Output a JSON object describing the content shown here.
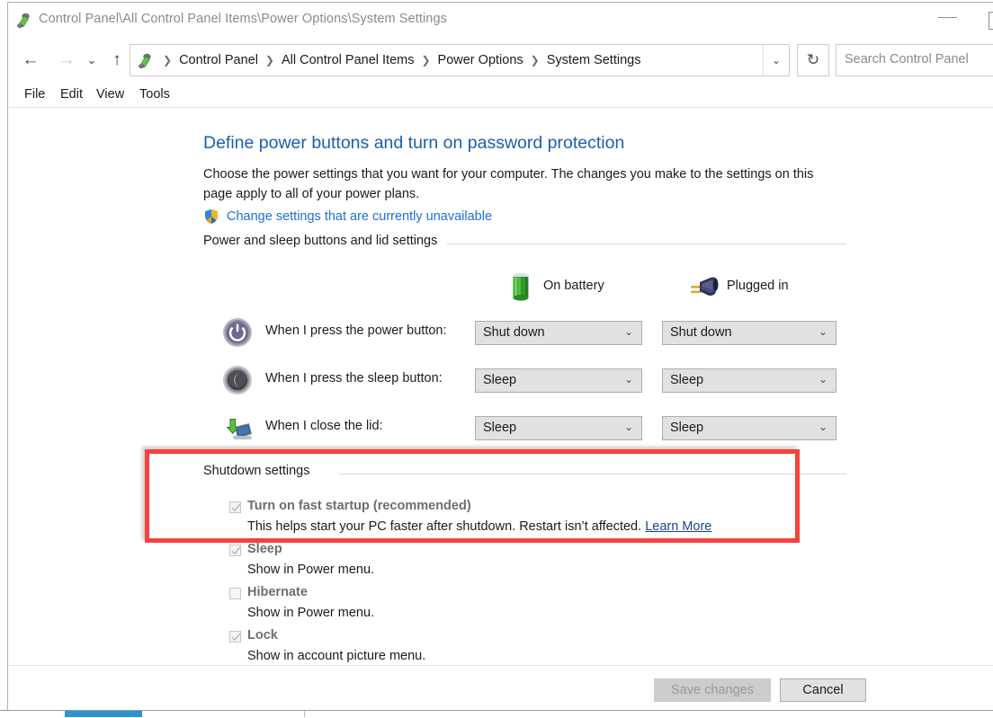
{
  "window": {
    "title": "Control Panel\\All Control Panel Items\\Power Options\\System Settings",
    "title_icon": "power-options-icon",
    "minimize_label": "Minimize",
    "maximize_label": "Maximize"
  },
  "nav": {
    "back_icon": "←",
    "forward_icon": "→",
    "recent_icon": "⌄",
    "up_icon": "↑",
    "refresh_icon": "↻",
    "address_dropdown_icon": "⌄",
    "breadcrumb_separator": "❯",
    "breadcrumbs": [
      "Control Panel",
      "All Control Panel Items",
      "Power Options",
      "System Settings"
    ]
  },
  "search": {
    "placeholder": "Search Control Panel",
    "value": ""
  },
  "menu": {
    "items": [
      "File",
      "Edit",
      "View",
      "Tools"
    ]
  },
  "page": {
    "title": "Define power buttons and turn on password protection",
    "description": "Choose the power settings that you want for your computer. The changes you make to the settings on this page apply to all of your power plans.",
    "uac_link": "Change settings that are currently unavailable",
    "uac_icon": "shield-icon"
  },
  "groups": {
    "power_lid": "Power and sleep buttons and lid settings",
    "shutdown": "Shutdown settings"
  },
  "columns": [
    {
      "label": "On battery",
      "icon": "battery-icon"
    },
    {
      "label": "Plugged in",
      "icon": "power-plug-icon"
    }
  ],
  "settings_rows": [
    {
      "icon": "power-button-icon",
      "label": "When I press the power button:",
      "on_battery": "Shut down",
      "plugged_in": "Shut down"
    },
    {
      "icon": "sleep-moon-icon",
      "label": "When I press the sleep button:",
      "on_battery": "Sleep",
      "plugged_in": "Sleep"
    },
    {
      "icon": "laptop-lid-icon",
      "label": "When I close the lid:",
      "on_battery": "Sleep",
      "plugged_in": "Sleep"
    }
  ],
  "dropdown_arrow": "⌄",
  "shutdown_options": [
    {
      "label": "Turn on fast startup (recommended)",
      "checked": true,
      "disabled": true,
      "description": "This helps start your PC faster after shutdown. Restart isn’t affected. ",
      "link": "Learn More"
    },
    {
      "label": "Sleep",
      "checked": true,
      "disabled": true,
      "description": "Show in Power menu.",
      "link": ""
    },
    {
      "label": "Hibernate",
      "checked": false,
      "disabled": true,
      "description": "Show in Power menu.",
      "link": ""
    },
    {
      "label": "Lock",
      "checked": true,
      "disabled": true,
      "description": "Show in account picture menu.",
      "link": ""
    }
  ],
  "footer": {
    "save_label": "Save changes",
    "save_disabled": true,
    "cancel_label": "Cancel"
  },
  "annotation": {
    "type": "red-highlight-rectangle",
    "color": "#f4433c"
  }
}
